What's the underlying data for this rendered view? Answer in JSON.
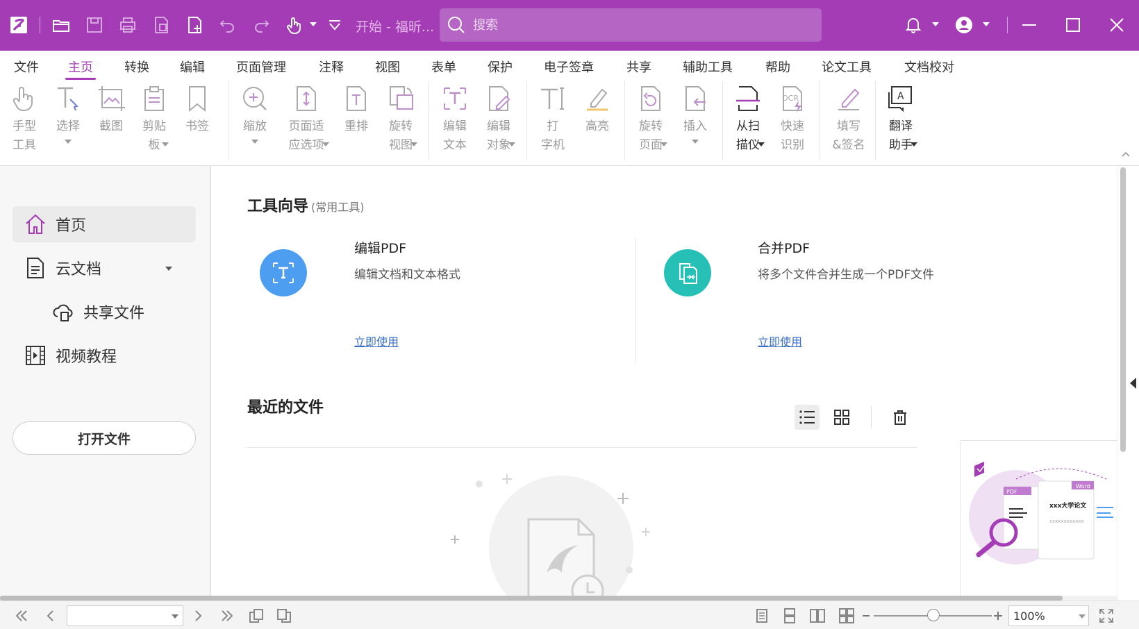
{
  "titlebar": {
    "title": "开始 - 福昕...",
    "search_placeholder": "搜索",
    "accent": "#a43cb6"
  },
  "menu": {
    "items": [
      "文件",
      "主页",
      "转换",
      "编辑",
      "页面管理",
      "注释",
      "视图",
      "表单",
      "保护",
      "电子签章",
      "共享",
      "辅助工具",
      "帮助",
      "论文工具",
      "文档校对"
    ],
    "active": "主页"
  },
  "ribbon": {
    "hand": "手型\n工具",
    "select": "选择",
    "screenshot": "截图",
    "clipboard": "剪贴\n板",
    "bookmark": "书签",
    "zoom": "缩放",
    "fit_page": "页面适\n应选项",
    "reflow": "重排",
    "rotate_view": "旋转\n视图",
    "edit_text": "编辑\n文本",
    "edit_object": "编辑\n对象",
    "typewriter": "打\n字机",
    "highlight": "高亮",
    "rotate_page": "旋转\n页面",
    "insert": "插入",
    "from_scanner": "从扫\n描仪",
    "quick_ocr": "快速\n识别",
    "fill_sign": "填写\n&签名",
    "translate": "翻译\n助手"
  },
  "sidebar": {
    "home": "首页",
    "cloud_docs": "云文档",
    "shared_files": "共享文件",
    "video_tutorials": "视频教程",
    "open_file": "打开文件"
  },
  "main": {
    "tools_heading": "工具向导",
    "tools_subheading": "(常用工具)",
    "card1_title": "编辑PDF",
    "card1_desc": "编辑文档和文本格式",
    "card1_link": "立即使用",
    "card2_title": "合并PDF",
    "card2_desc": "将多个文件合并生成一个PDF文件",
    "card2_link": "立即使用",
    "recent_heading": "最近的文件",
    "promo_pdf": "PDF",
    "promo_word": "Word",
    "promo_doc_title": "xxx大学论文",
    "promo_doc_body": "xxxxxxxxxxxx"
  },
  "status": {
    "zoom": "100%"
  }
}
